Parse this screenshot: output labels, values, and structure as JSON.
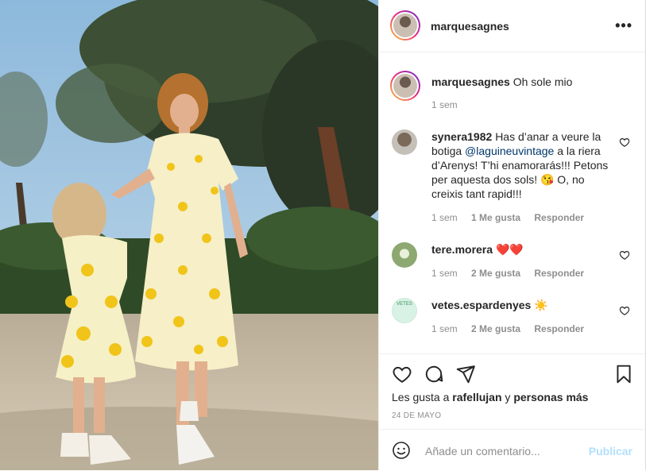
{
  "post": {
    "author": "marquesagnes",
    "caption_user": "marquesagnes",
    "caption_text": "Oh sole mio",
    "caption_time": "1 sem",
    "more_icon": "more-horizontal-icon"
  },
  "comments": [
    {
      "user": "synera1982",
      "text_before": "Has d’anar a veure la botiga ",
      "mention": "@laguineuvintage",
      "text_after": " a la riera d’Arenys! T’hi enamorarás!!! Petons per aquesta dos sols! 😘 O, no creixis tant rapid!!!",
      "time": "1 sem",
      "likes": "1 Me gusta",
      "reply": "Responder"
    },
    {
      "user": "tere.morera",
      "text_before": "❤️❤️",
      "mention": "",
      "text_after": "",
      "time": "1 sem",
      "likes": "2 Me gusta",
      "reply": "Responder"
    },
    {
      "user": "vetes.espardenyes",
      "text_before": "☀️",
      "mention": "",
      "text_after": "",
      "time": "1 sem",
      "likes": "2 Me gusta",
      "reply": "Responder"
    }
  ],
  "likes": {
    "prefix": "Les gusta a ",
    "user": "rafellujan",
    "middle": " y ",
    "others": "personas más"
  },
  "date": "24 DE MAYO",
  "add_comment": {
    "placeholder": "Añade un comentario...",
    "publish": "Publicar"
  },
  "vetes_avatar_text": "VETES",
  "colors": {
    "link": "#00376b",
    "muted": "#8e8e8e",
    "publish_disabled": "#b2dffc"
  }
}
